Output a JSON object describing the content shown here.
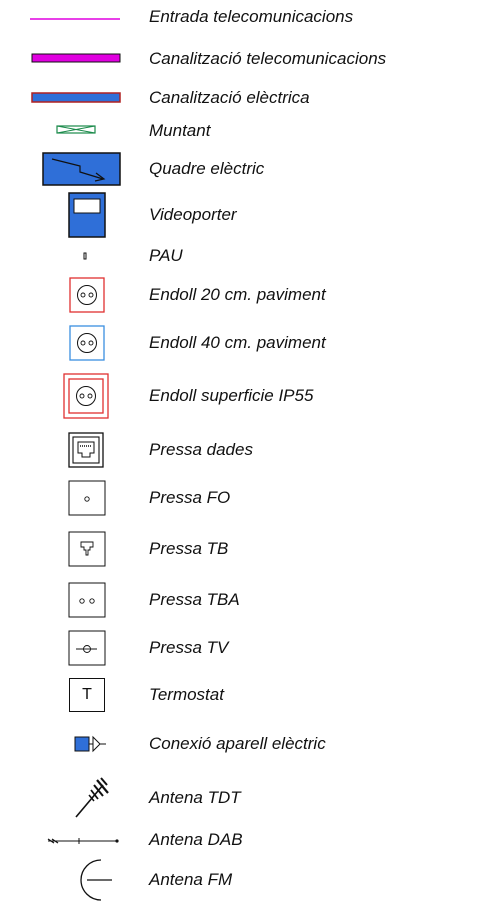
{
  "colors": {
    "telecom": "#e000e0",
    "electric": "#2f6fd8",
    "muntant": "#1a8a4a",
    "socket_red": "#e03030",
    "socket_blue": "#3a8ee0",
    "line": "#111111"
  },
  "legend": [
    {
      "icon": "telecom-entry-line-icon",
      "label": "Entrada telecomunicacions"
    },
    {
      "icon": "telecom-conduit-icon",
      "label": "Canalització telecomunicacions"
    },
    {
      "icon": "electric-conduit-icon",
      "label": "Canalització elèctrica"
    },
    {
      "icon": "riser-icon",
      "label": "Muntant"
    },
    {
      "icon": "electrical-panel-icon",
      "label": "Quadre elèctric"
    },
    {
      "icon": "video-intercom-icon",
      "label": "Videoporter"
    },
    {
      "icon": "pau-icon",
      "label": "PAU"
    },
    {
      "icon": "socket-20cm-floor-icon",
      "label": "Endoll 20 cm. paviment"
    },
    {
      "icon": "socket-40cm-floor-icon",
      "label": "Endoll 40 cm. paviment"
    },
    {
      "icon": "socket-ip55-icon",
      "label": "Endoll superficie IP55"
    },
    {
      "icon": "data-outlet-icon",
      "label": "Pressa dades"
    },
    {
      "icon": "fiber-outlet-icon",
      "label": "Pressa FO"
    },
    {
      "icon": "tb-outlet-icon",
      "label": "Pressa TB"
    },
    {
      "icon": "tba-outlet-icon",
      "label": "Pressa TBA"
    },
    {
      "icon": "tv-outlet-icon",
      "label": "Pressa TV"
    },
    {
      "icon": "thermostat-icon",
      "label": "Termostat",
      "glyph": "T"
    },
    {
      "icon": "appliance-connection-icon",
      "label": "Conexió aparell elèctric"
    },
    {
      "icon": "dtt-antenna-icon",
      "label": "Antena TDT"
    },
    {
      "icon": "dab-antenna-icon",
      "label": "Antena DAB"
    },
    {
      "icon": "fm-antenna-icon",
      "label": "Antena FM"
    }
  ]
}
